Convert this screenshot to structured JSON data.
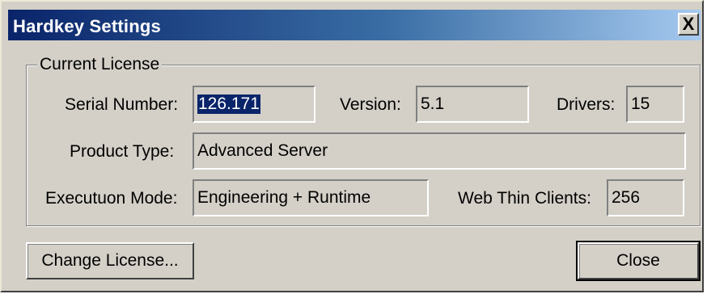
{
  "window": {
    "title": "Hardkey Settings",
    "close_glyph": "X"
  },
  "license_group": {
    "label": "Current License",
    "serial_number": {
      "label": "Serial Number:",
      "value": "126.171"
    },
    "version": {
      "label": "Version:",
      "value": "5.1"
    },
    "drivers": {
      "label": "Drivers:",
      "value": "15"
    },
    "product_type": {
      "label": "Product Type:",
      "value": "Advanced Server"
    },
    "execution_mode": {
      "label": "Executuon Mode:",
      "value": "Engineering + Runtime"
    },
    "web_thin_clients": {
      "label": "Web Thin Clients:",
      "value": "256"
    }
  },
  "buttons": {
    "change_license": "Change License...",
    "close": "Close"
  },
  "colors": {
    "dialog_face": "#d4d0c8",
    "titlebar_start": "#0a246a",
    "titlebar_end": "#a6caf0",
    "selection": "#0a246a"
  }
}
